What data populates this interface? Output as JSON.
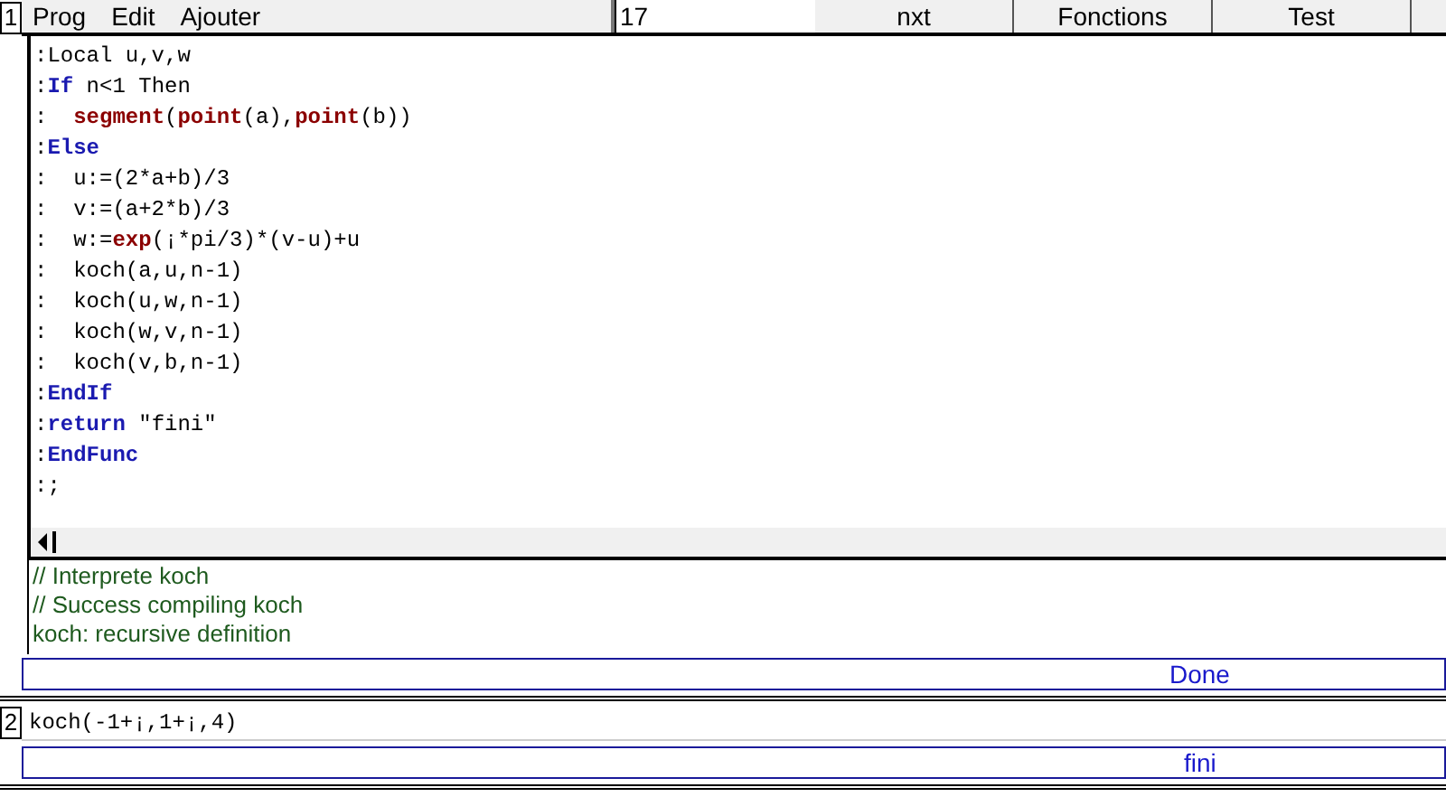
{
  "level1": {
    "number": "1",
    "menu": [
      "Prog",
      "Edit",
      "Ajouter"
    ],
    "field_value": "17",
    "buttons": [
      "nxt",
      "Fonctions",
      "Test"
    ],
    "code_lines": [
      [
        {
          "kind": "plain",
          "text": ":Local u,v,w"
        }
      ],
      [
        {
          "kind": "plain",
          "text": ":"
        },
        {
          "kind": "keyword",
          "text": "If"
        },
        {
          "kind": "plain",
          "text": " n<1 Then"
        }
      ],
      [
        {
          "kind": "plain",
          "text": ":  "
        },
        {
          "kind": "func",
          "text": "segment"
        },
        {
          "kind": "plain",
          "text": "("
        },
        {
          "kind": "func",
          "text": "point"
        },
        {
          "kind": "plain",
          "text": "(a),"
        },
        {
          "kind": "func",
          "text": "point"
        },
        {
          "kind": "plain",
          "text": "(b))"
        }
      ],
      [
        {
          "kind": "plain",
          "text": ":"
        },
        {
          "kind": "keyword",
          "text": "Else"
        }
      ],
      [
        {
          "kind": "plain",
          "text": ":  u:=(2*a+b)/3"
        }
      ],
      [
        {
          "kind": "plain",
          "text": ":  v:=(a+2*b)/3"
        }
      ],
      [
        {
          "kind": "plain",
          "text": ":  w:="
        },
        {
          "kind": "func",
          "text": "exp"
        },
        {
          "kind": "plain",
          "text": "(¡*pi/3)*(v-u)+u"
        }
      ],
      [
        {
          "kind": "plain",
          "text": ":  koch(a,u,n-1)"
        }
      ],
      [
        {
          "kind": "plain",
          "text": ":  koch(u,w,n-1)"
        }
      ],
      [
        {
          "kind": "plain",
          "text": ":  koch(w,v,n-1)"
        }
      ],
      [
        {
          "kind": "plain",
          "text": ":  koch(v,b,n-1)"
        }
      ],
      [
        {
          "kind": "plain",
          "text": ":"
        },
        {
          "kind": "keyword",
          "text": "EndIf"
        }
      ],
      [
        {
          "kind": "plain",
          "text": ":"
        },
        {
          "kind": "keyword",
          "text": "return"
        },
        {
          "kind": "plain",
          "text": " \"fini\""
        }
      ],
      [
        {
          "kind": "plain",
          "text": ":"
        },
        {
          "kind": "keyword",
          "text": "EndFunc"
        }
      ],
      [
        {
          "kind": "plain",
          "text": ":;"
        }
      ]
    ],
    "messages": [
      "// Interprete koch",
      "// Success compiling koch",
      "koch: recursive definition"
    ],
    "answer": "Done"
  },
  "level2": {
    "number": "2",
    "input": "koch(-1+¡,1+¡,4)",
    "answer": "fini"
  }
}
